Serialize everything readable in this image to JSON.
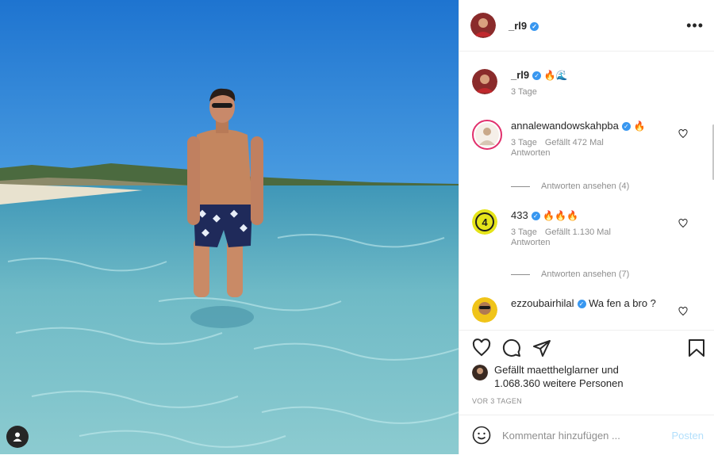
{
  "post": {
    "username": "_rl9",
    "more_icon": "more-horizontal-icon"
  },
  "caption": {
    "username": "_rl9",
    "text": "🔥🌊",
    "time": "3 Tage"
  },
  "comments": [
    {
      "username": "annalewandowskahpba",
      "text": "🔥",
      "time": "3 Tage",
      "likes": "Gefällt 472 Mal",
      "reply": "Antworten",
      "view_replies": "Antworten ansehen (4)"
    },
    {
      "username": "433",
      "text": "🔥🔥🔥",
      "time": "3 Tage",
      "likes": "Gefällt 1.130 Mal",
      "reply": "Antworten",
      "view_replies": "Antworten ansehen (7)"
    },
    {
      "username": "ezzoubairhilal",
      "text": "Wa fen a bro ?",
      "time": "",
      "likes": "",
      "reply": "",
      "view_replies": ""
    }
  ],
  "liked_by": {
    "prefix": "Gefällt ",
    "user": "maetthelglarner",
    "suffix": " und",
    "line2": "1.068.360 weitere Personen"
  },
  "timestamp": "VOR 3 TAGEN",
  "compose": {
    "placeholder": "Kommentar hinzufügen ...",
    "post_label": "Posten"
  },
  "colors": {
    "verified": "#3897f0",
    "post_disabled": "#b2dffc",
    "sky": "#2f86d6",
    "sea": "#5fb6c5"
  }
}
